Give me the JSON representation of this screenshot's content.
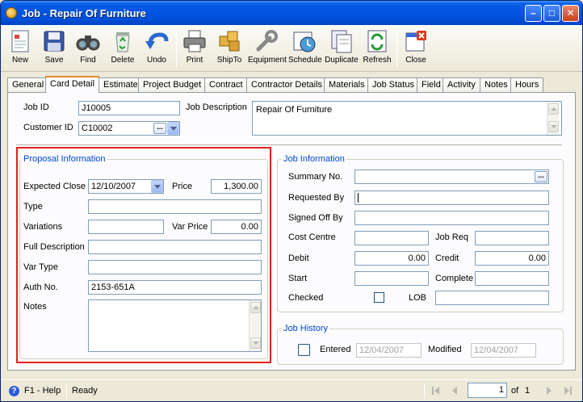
{
  "window": {
    "title": "Job - Repair Of Furniture"
  },
  "toolbar": {
    "new": "New",
    "save": "Save",
    "find": "Find",
    "delete": "Delete",
    "undo": "Undo",
    "print": "Print",
    "shipto": "ShipTo",
    "equipment": "Equipment",
    "schedule": "Schedule",
    "duplicate": "Duplicate",
    "refresh": "Refresh",
    "close": "Close"
  },
  "tabs": [
    "General",
    "Card Detail",
    "Estimate",
    "Project Budget",
    "Contract",
    "Contractor Details",
    "Materials",
    "Job Status",
    "Field",
    "Activity",
    "Notes",
    "Hours"
  ],
  "header": {
    "job_id_label": "Job ID",
    "job_id": "J10005",
    "customer_id_label": "Customer ID",
    "customer_id": "C10002",
    "job_description_label": "Job Description",
    "job_description": "Repair Of Furniture"
  },
  "proposal": {
    "title": "Proposal Information",
    "expected_close_label": "Expected Close",
    "expected_close": "12/10/2007",
    "price_label": "Price",
    "price": "1,300.00",
    "type_label": "Type",
    "type": "",
    "variations_label": "Variations",
    "variations": "",
    "var_price_label": "Var Price",
    "var_price": "0.00",
    "full_description_label": "Full Description",
    "full_description": "",
    "var_type_label": "Var Type",
    "var_type": "",
    "auth_no_label": "Auth No.",
    "auth_no": "2153-651A",
    "notes_label": "Notes",
    "notes": ""
  },
  "job_info": {
    "title": "Job Information",
    "summary_no_label": "Summary No.",
    "summary_no": "",
    "requested_by_label": "Requested By",
    "requested_by": "",
    "signed_off_by_label": "Signed Off By",
    "signed_off_by": "",
    "cost_centre_label": "Cost Centre",
    "cost_centre": "",
    "job_req_label": "Job Req",
    "job_req": "",
    "debit_label": "Debit",
    "debit": "0.00",
    "credit_label": "Credit",
    "credit": "0.00",
    "start_label": "Start",
    "start": "",
    "complete_label": "Complete",
    "complete": "",
    "checked_label": "Checked",
    "lob_label": "LOB",
    "lob": ""
  },
  "job_history": {
    "title": "Job History",
    "entered_label": "Entered",
    "entered": "12/04/2007",
    "modified_label": "Modified",
    "modified": "12/04/2007"
  },
  "status": {
    "help": "F1 - Help",
    "state": "Ready",
    "page": "1",
    "of_label": "of",
    "total": "1"
  },
  "colors": {
    "highlight_border": "#e0201e",
    "group_title": "#0046d5",
    "titlebar": "#0054e3"
  }
}
